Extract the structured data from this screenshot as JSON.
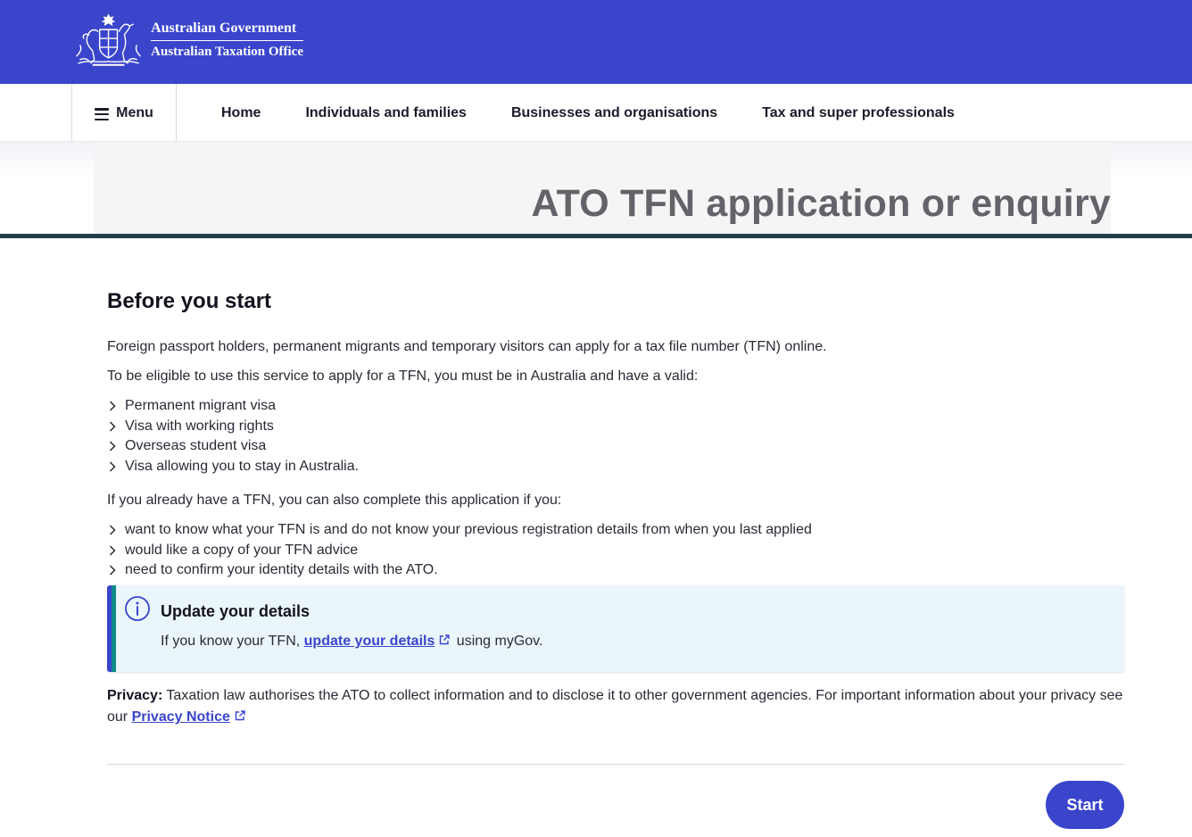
{
  "header": {
    "logo_line1": "Australian Government",
    "logo_line2": "Australian Taxation Office",
    "crest_icon": "commonwealth-coat-of-arms-icon",
    "background_color": "#3a45cc"
  },
  "nav": {
    "menu_label": "Menu",
    "links": [
      "Home",
      "Individuals and families",
      "Businesses and organisations",
      "Tax and super professionals"
    ]
  },
  "banner": {
    "title": "ATO TFN application or enquiry"
  },
  "main": {
    "heading": "Before you start",
    "intro": "Foreign passport holders, permanent migrants and temporary visitors can apply for a tax file number (TFN) online.",
    "eligibility_lead": "To be eligible to use this service to apply for a TFN, you must be in Australia and have a valid:",
    "eligibility_items": [
      "Permanent migrant visa",
      "Visa with working rights",
      "Overseas student visa",
      "Visa allowing you to stay in Australia."
    ],
    "existing_lead": "If you already have a TFN, you can also complete this application if you:",
    "existing_items": [
      "want to know what your TFN is and do not know your previous registration details from when you last applied",
      "would like a copy of your TFN advice",
      "need to confirm your identity details with the ATO."
    ],
    "callout": {
      "title": "Update your details",
      "text_before": "If you know your TFN, ",
      "link_text": "update your details",
      "text_after": " using myGov."
    },
    "privacy": {
      "label": "Privacy:",
      "text": " Taxation law authorises the ATO to collect information and to disclose it to other government agencies. For important information about your privacy see our ",
      "link_text": "Privacy Notice"
    },
    "start_label": "Start"
  },
  "colors": {
    "brand_blue": "#3a45cc",
    "banner_rule": "#22404a",
    "callout_bg": "#ebf6fb",
    "callout_accent": "#0f8a8a"
  }
}
